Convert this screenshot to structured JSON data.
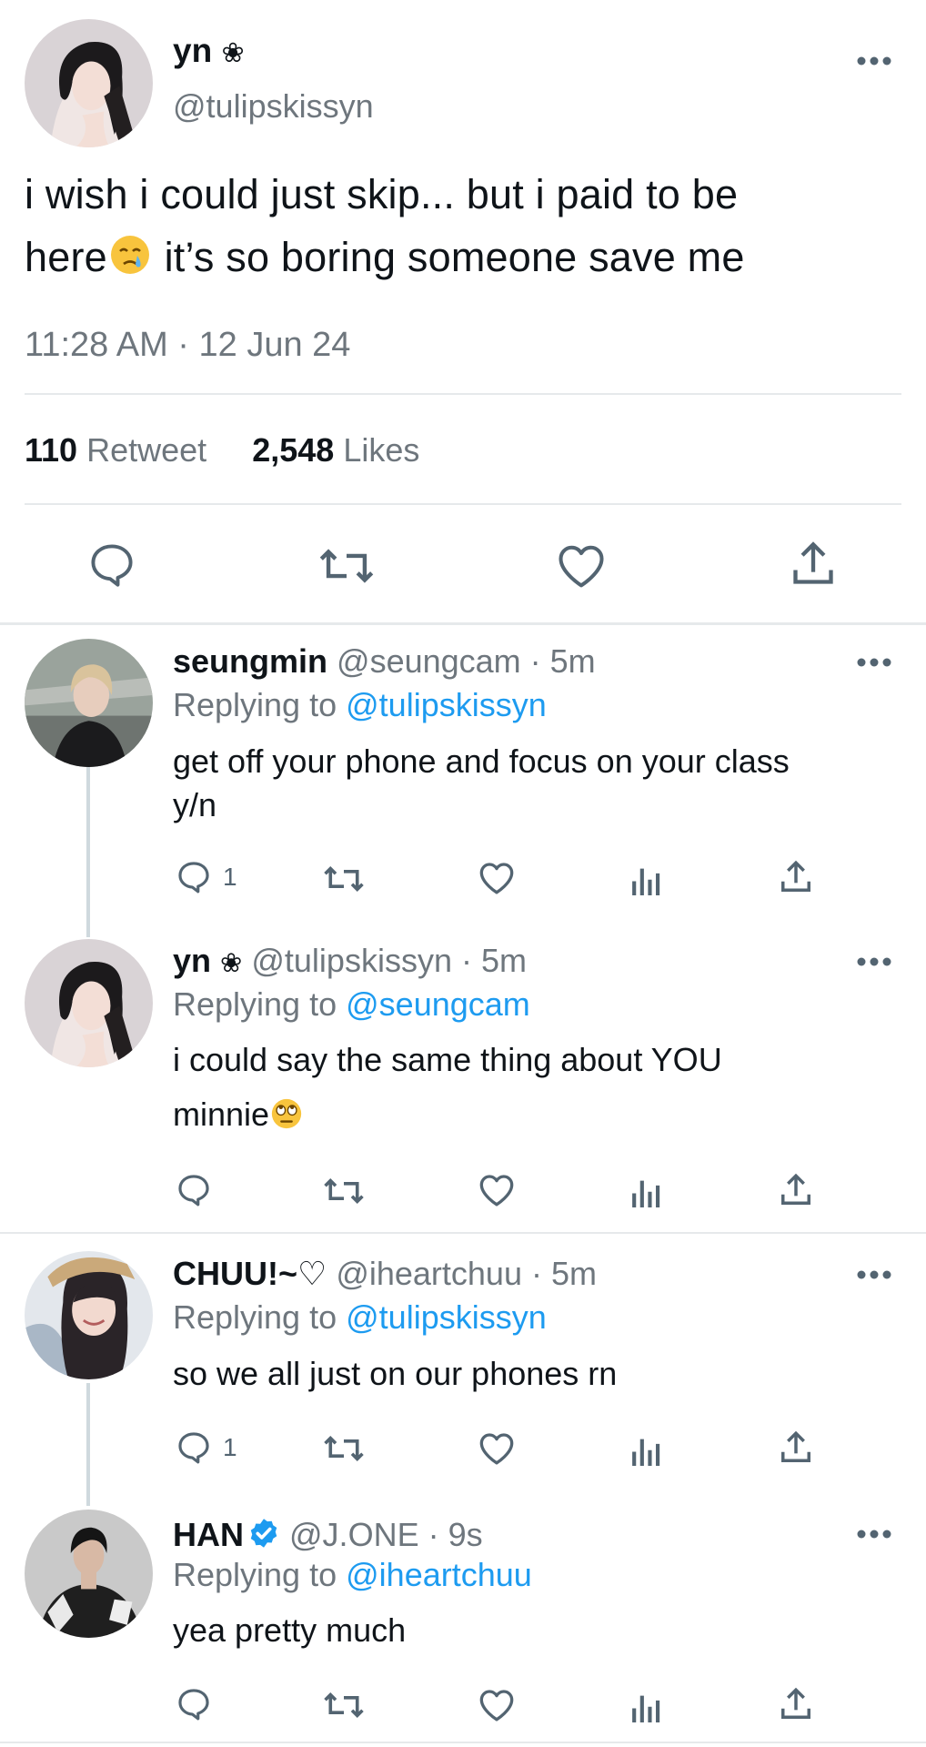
{
  "main_tweet": {
    "display_name": "yn",
    "name_symbol": "❀",
    "handle": "@tulipskissyn",
    "text_line1": "i wish i could just skip... but i paid to be",
    "text_line2_a": "here",
    "text_line2_b": " it’s so boring someone save me",
    "timestamp": "11:28 AM · 12 Jun 24",
    "retweet_count": "110",
    "retweet_label": "Retweet",
    "likes_count": "2,548",
    "likes_label": "Likes"
  },
  "replies": [
    {
      "display_name": "seungmin",
      "handle": "@seungcam",
      "time": " · 5m",
      "replying_to_label": "Replying to",
      "replying_to": "@tulipskissyn",
      "text_line1": "get off your phone and focus on your class",
      "text_line2": "y/n",
      "reply_count": "1"
    },
    {
      "display_name": "yn",
      "name_symbol": "❀",
      "handle": "@tulipskissyn",
      "time": " · 5m",
      "replying_to_label": "Replying to",
      "replying_to": "@seungcam",
      "text_line1": "i could say the same thing about YOU",
      "text_line2": "minnie",
      "reply_count": ""
    },
    {
      "display_name": "CHUU!~",
      "name_symbol": "♡",
      "handle": "@iheartchuu",
      "time": " · 5m",
      "replying_to_label": "Replying to",
      "replying_to": "@tulipskissyn",
      "text_line1": "so we all just on our phones rn",
      "reply_count": "1"
    },
    {
      "display_name": "HAN",
      "verified": true,
      "handle": "@J.ONE",
      "time": " · 9s",
      "replying_to_label": "Replying to",
      "replying_to": "@iheartchuu",
      "text_line1": "yea pretty much",
      "reply_count": ""
    }
  ],
  "icons": [
    "more-icon",
    "reply-icon",
    "retweet-icon",
    "like-icon",
    "share-icon",
    "analytics-icon",
    "verified-badge-icon",
    "crying-emoji",
    "eye-roll-emoji"
  ],
  "colors": {
    "link": "#1d9bf0",
    "secondary_text": "#6e767d",
    "icon": "#536471",
    "verified": "#1d9bf0"
  }
}
